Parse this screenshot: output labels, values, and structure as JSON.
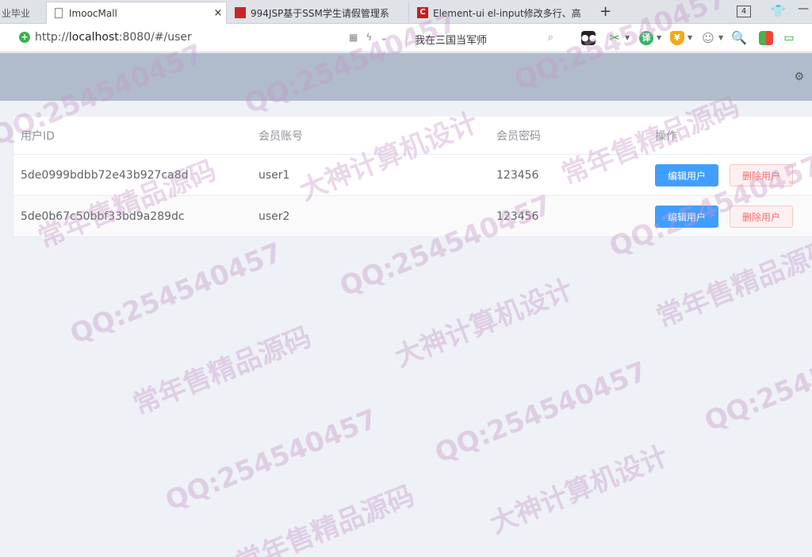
{
  "browser": {
    "tabs": [
      {
        "label": "业毕业"
      },
      {
        "label": "ImoocMall",
        "close": "×"
      },
      {
        "label": "994JSP基于SSM学生请假管理系"
      },
      {
        "label": "Element-ui el-input修改多行、高"
      }
    ],
    "new_tab": "+",
    "tab_count": "4",
    "url_prefix": "http://",
    "url_host": "localhost",
    "url_rest": ":8080/#/user",
    "search_text": "我在三国当军师",
    "favicon_c": "C",
    "ext_translate": "译",
    "ext_wallet": "¥",
    "icons": [
      "shield-icon",
      "qr-icon",
      "lightning-icon",
      "chevron-down-icon",
      "search-icon",
      "extension-icons",
      "settings-icon"
    ]
  },
  "table": {
    "headers": [
      "用户ID",
      "会员账号",
      "会员密码",
      "操作"
    ],
    "rows": [
      {
        "id": "5de0999bdbb72e43b927ca8d",
        "account": "user1",
        "password": "123456",
        "edit": "编辑用户",
        "delete": "删除用户"
      },
      {
        "id": "5de0b67c50bbf33bd9a289dc",
        "account": "user2",
        "password": "123456",
        "edit": "编辑用户",
        "delete": "删除用户"
      }
    ]
  },
  "watermark": {
    "qq": "QQ:254540457",
    "brand1": "大神计算机设计",
    "brand2": "常年售精品源码"
  },
  "colors": {
    "primary": "#409eff",
    "danger": "#f56c6c",
    "header": "#b0bccb"
  }
}
